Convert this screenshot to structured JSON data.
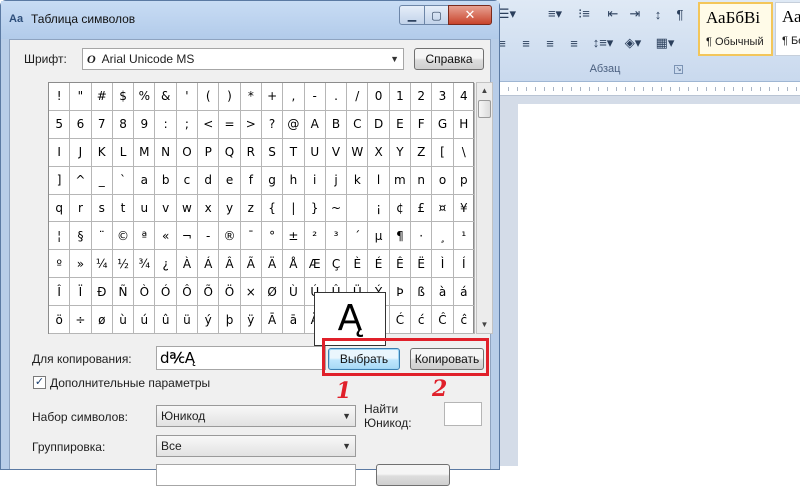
{
  "word": {
    "group_label": "Абзац",
    "style_active_sample": "АаБбВі",
    "style_active_name": "¶ Обычный",
    "style_next_name": "¶ Без",
    "toolbar_pilcrow": "¶"
  },
  "dialog": {
    "title": "Таблица символов",
    "font_label": "Шрифт:",
    "font_icon_glyph": "O",
    "font_value": "Arial Unicode MS",
    "help_button": "Справка",
    "grid_rows": [
      [
        "!",
        "\"",
        "#",
        "$",
        "%",
        "&",
        "'",
        "(",
        ")",
        "*",
        "+",
        ",",
        "-",
        ".",
        "/",
        "0",
        "1",
        "2",
        "3",
        "4"
      ],
      [
        "5",
        "6",
        "7",
        "8",
        "9",
        ":",
        ";",
        "<",
        "=",
        ">",
        "?",
        "@",
        "A",
        "B",
        "C",
        "D",
        "E",
        "F",
        "G",
        "H"
      ],
      [
        "I",
        "J",
        "K",
        "L",
        "M",
        "N",
        "O",
        "P",
        "Q",
        "R",
        "S",
        "T",
        "U",
        "V",
        "W",
        "X",
        "Y",
        "Z",
        "[",
        "\\"
      ],
      [
        "]",
        "^",
        "_",
        "`",
        "a",
        "b",
        "c",
        "d",
        "e",
        "f",
        "g",
        "h",
        "i",
        "j",
        "k",
        "l",
        "m",
        "n",
        "o",
        "p"
      ],
      [
        "q",
        "r",
        "s",
        "t",
        "u",
        "v",
        "w",
        "x",
        "y",
        "z",
        "{",
        "|",
        "}",
        "~",
        " ",
        "¡",
        "¢",
        "£",
        "¤",
        "¥"
      ],
      [
        "¦",
        "§",
        "¨",
        "©",
        "ª",
        "«",
        "¬",
        "-",
        "®",
        "¯",
        "°",
        "±",
        "²",
        "³",
        "´",
        "µ",
        "¶",
        "·",
        "¸",
        "¹"
      ],
      [
        "º",
        "»",
        "¼",
        "½",
        "¾",
        "¿",
        "À",
        "Á",
        "Â",
        "Ã",
        "Ä",
        "Å",
        "Æ",
        "Ç",
        "È",
        "É",
        "Ê",
        "Ë",
        "Ì",
        "Í"
      ],
      [
        "Î",
        "Ï",
        "Ð",
        "Ñ",
        "Ò",
        "Ó",
        "Ô",
        "Õ",
        "Ö",
        "×",
        "Ø",
        "Ù",
        "Ú",
        "Û",
        "Ü",
        "Ý",
        "Þ",
        "ß",
        "à",
        "á"
      ],
      [
        "â",
        "ã",
        "ä",
        "å",
        "æ",
        "ç",
        "è",
        "é",
        "ê",
        "ë",
        "ì",
        "í",
        "î",
        "ï",
        "ð",
        "ñ",
        "ò",
        "ó",
        "ô",
        "õ"
      ],
      [
        "ö",
        "÷",
        "ø",
        "ù",
        "ú",
        "û",
        "ü",
        "ý",
        "þ",
        "ÿ",
        "Ā",
        "ā",
        "Ă",
        "ă",
        "Ą",
        "ą",
        "Ć",
        "ć",
        "Ĉ",
        "ĉ"
      ]
    ],
    "zoom_char": "Ą",
    "copy_label": "Для копирования:",
    "copy_value": "d℀Ą",
    "select_button": "Выбрать",
    "copy_button": "Копировать",
    "advanced_label": "Дополнительные параметры",
    "advanced_checked": "✓",
    "charset_label": "Набор символов:",
    "charset_value": "Юникод",
    "grouping_label": "Группировка:",
    "grouping_value": "Все",
    "unicode_label_1": "Найти",
    "unicode_label_2": "Юникод:"
  },
  "annotations": {
    "one": "1",
    "two": "2"
  },
  "colors": {
    "highlight": "#e0202a"
  }
}
